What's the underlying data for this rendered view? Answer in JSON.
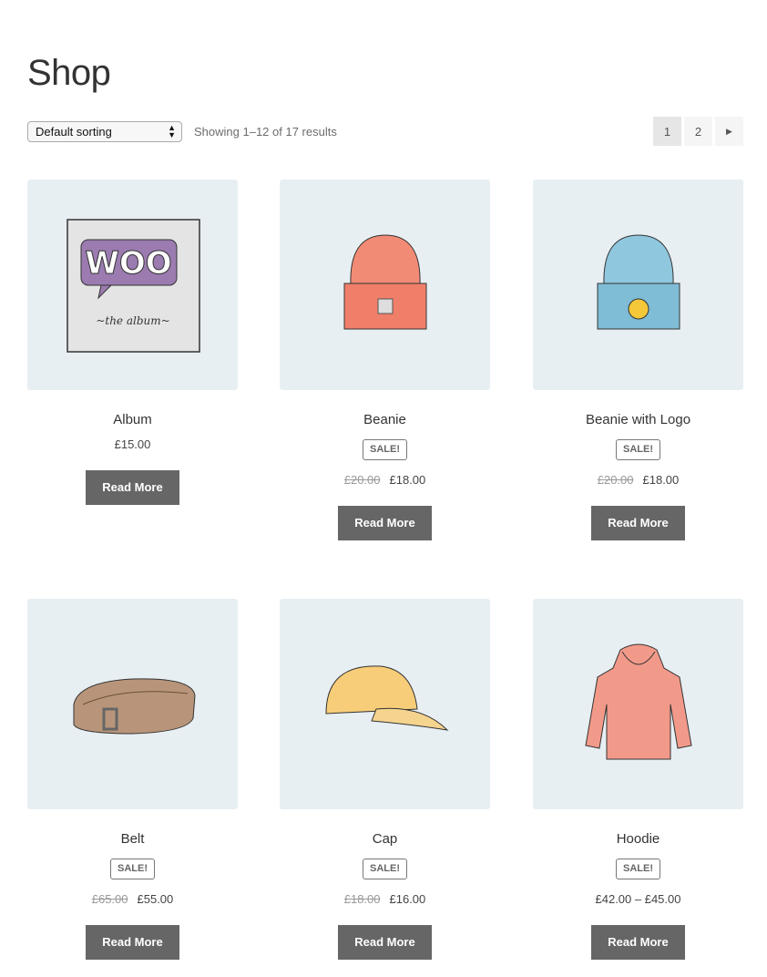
{
  "page": {
    "title": "Shop"
  },
  "toolbar": {
    "sort_value": "Default sorting",
    "result_count": "Showing 1–12 of 17 results",
    "pages": [
      "1",
      "2"
    ],
    "current_page": "1",
    "next_icon": "triangle-right-icon"
  },
  "colors": {
    "image_bg": "#e8eff3",
    "button_bg": "#666666"
  },
  "products": [
    {
      "name": "Album",
      "sale": "",
      "old_price": "",
      "price": "£15.00",
      "button": "Read More",
      "image": "album"
    },
    {
      "name": "Beanie",
      "sale": "SALE!",
      "old_price": "£20.00",
      "price": "£18.00",
      "button": "Read More",
      "image": "beanie"
    },
    {
      "name": "Beanie with Logo",
      "sale": "SALE!",
      "old_price": "£20.00",
      "price": "£18.00",
      "button": "Read More",
      "image": "beanie-logo"
    },
    {
      "name": "Belt",
      "sale": "SALE!",
      "old_price": "£65.00",
      "price": "£55.00",
      "button": "Read More",
      "image": "belt"
    },
    {
      "name": "Cap",
      "sale": "SALE!",
      "old_price": "£18.00",
      "price": "£16.00",
      "button": "Read More",
      "image": "cap"
    },
    {
      "name": "Hoodie",
      "sale": "SALE!",
      "old_price": "",
      "price": "£42.00 – £45.00",
      "button": "Read More",
      "image": "hoodie"
    }
  ]
}
